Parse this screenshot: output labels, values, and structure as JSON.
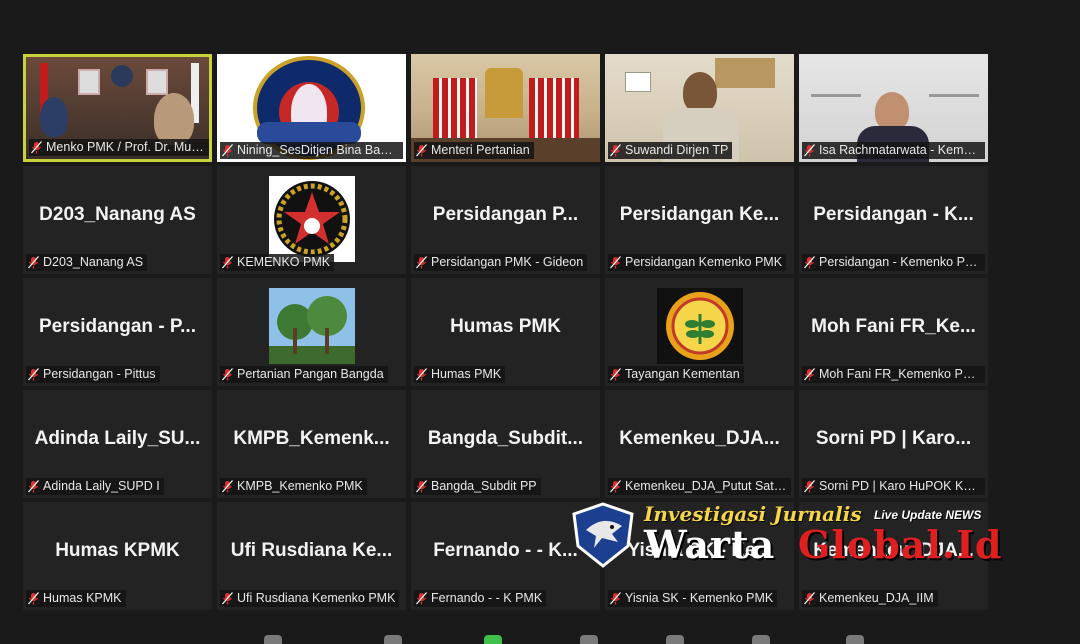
{
  "tiles": [
    {
      "label": "Menko PMK / Prof. Dr. Muhadjir Effendy",
      "kind": "video",
      "scene": "menko",
      "active": true
    },
    {
      "label": "Nining_SesDitjen Bina Bangda",
      "kind": "video",
      "scene": "nining"
    },
    {
      "label": "Menteri Pertanian",
      "kind": "video",
      "scene": "mentan"
    },
    {
      "label": "Suwandi Dirjen TP",
      "kind": "video",
      "scene": "suwandi"
    },
    {
      "label": "Isa Rachmatarwata - Kemenkeu",
      "kind": "video",
      "scene": "isa"
    },
    {
      "label": "D203_Nanang AS",
      "big": "D203_Nanang AS"
    },
    {
      "label": "KEMENKO PMK",
      "kind": "logo",
      "logo": "kemenko-star-logo"
    },
    {
      "label": "Persidangan PMK - Gideon",
      "big": "Persidangan  P..."
    },
    {
      "label": "Persidangan Kemenko PMK",
      "big": "Persidangan  Ke..."
    },
    {
      "label": "Persidangan - Kemenko PMK",
      "big": "Persidangan  -  K..."
    },
    {
      "label": "Persidangan - Pittus",
      "big": "Persidangan  -  P..."
    },
    {
      "label": "Pertanian Pangan Bangda",
      "kind": "logo",
      "logo": "tree-photo"
    },
    {
      "label": "Humas PMK",
      "big": "Humas PMK"
    },
    {
      "label": "Tayangan Kementan",
      "kind": "logo",
      "logo": "kementan-logo"
    },
    {
      "label": "Moh Fani FR_Kemenko PMK",
      "big": "Moh Fani FR_Ke..."
    },
    {
      "label": "Adinda Laily_SUPD I",
      "big": "Adinda Laily_SU..."
    },
    {
      "label": "KMPB_Kemenko PMK",
      "big": "KMPB_Kemenk..."
    },
    {
      "label": "Bangda_Subdit PP",
      "big": "Bangda_Subdit..."
    },
    {
      "label": "Kemenkeu_DJA_Putut Satyaka",
      "big": "Kemenkeu_DJA..."
    },
    {
      "label": "Sorni PD | Karo HuPOK Kemenko PMK",
      "big": "Sorni PD | Karo..."
    },
    {
      "label": "Humas KPMK",
      "big": "Humas KPMK"
    },
    {
      "label": "Ufi Rusdiana Kemenko PMK",
      "big": "Ufi Rusdiana Ke..."
    },
    {
      "label": "Fernando - - K PMK",
      "big": "Fernando  -  -  K..."
    },
    {
      "label": "Yisnia SK - Kemenko PMK",
      "big": "Yisnia SK - Ke..."
    },
    {
      "label": "Kemenkeu_DJA_IIM",
      "big": "Kemenkeu_DJA..."
    }
  ],
  "watermark": {
    "line1": "Investigasi Jurnalis",
    "line2a": "Warta",
    "line2b": "Global.Id",
    "tag": "Live Update NEWS"
  },
  "colors": {
    "active_border": "#c8d23a",
    "muted_mic": "#e03030",
    "tile_bg": "#232323"
  }
}
